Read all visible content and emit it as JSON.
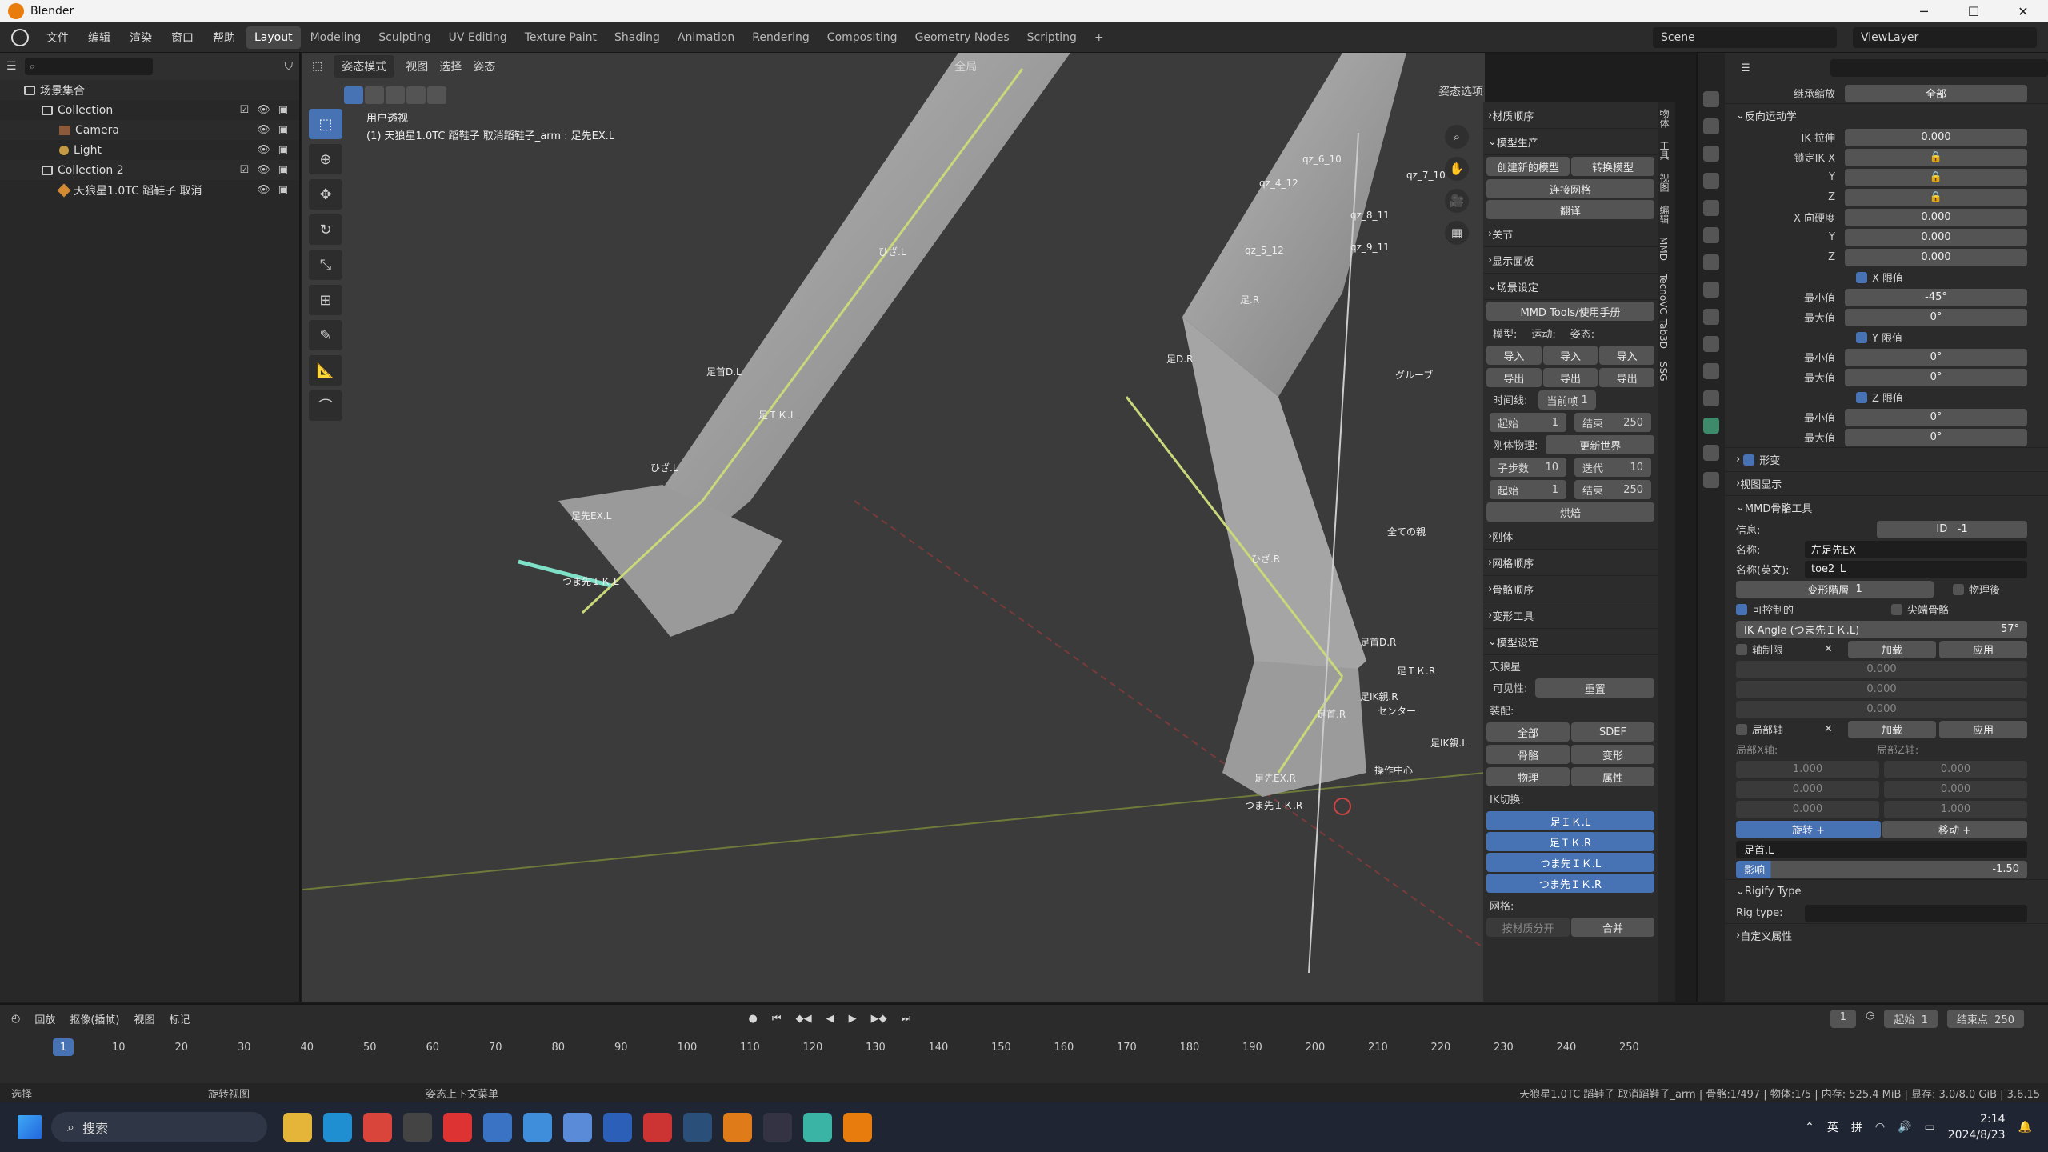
{
  "window": {
    "title": "Blender",
    "controls": [
      "─",
      "☐",
      "✕"
    ]
  },
  "menubar": {
    "menus": [
      "文件",
      "编辑",
      "渲染",
      "窗口",
      "帮助"
    ],
    "workspaces": [
      "Layout",
      "Modeling",
      "Sculpting",
      "UV Editing",
      "Texture Paint",
      "Shading",
      "Animation",
      "Rendering",
      "Compositing",
      "Geometry Nodes",
      "Scripting"
    ],
    "active_workspace": "Layout",
    "add_tab": "+",
    "scene": "Scene",
    "view_layer": "ViewLayer"
  },
  "outliner": {
    "root": "场景集合",
    "rows": [
      {
        "label": "Collection",
        "indent": 1,
        "type": "collection"
      },
      {
        "label": "Camera",
        "indent": 2,
        "type": "camera"
      },
      {
        "label": "Light",
        "indent": 2,
        "type": "light"
      },
      {
        "label": "Collection 2",
        "indent": 1,
        "type": "collection"
      },
      {
        "label": "天狼星1.0TC 蹈鞋子 取消",
        "indent": 2,
        "type": "armature"
      }
    ]
  },
  "viewport": {
    "mode": "姿态模式",
    "header_menus": [
      "视图",
      "选择",
      "姿态"
    ],
    "pivot": "全局",
    "overlay_label": "姿态选项",
    "info_line1": "用户透视",
    "info_line2": "(1) 天狼星1.0TC 蹈鞋子 取消蹈鞋子_arm : 足先EX.L",
    "bone_labels": [
      "ひざ.L",
      "足首D.L",
      "足ＩＫ.L",
      "ひざ.L",
      "足先EX.L",
      "つま先ＩＫ.L",
      "ひざ.R",
      "足首D.R",
      "足ＩＫ.R",
      "足IK親.R",
      "センター",
      "足首.R",
      "足先EX.R",
      "つま先ＩＫ.R",
      "操作中心",
      "足IK親.L",
      "グルーブ",
      "全ての親",
      "足.R",
      "足D.R",
      "qz_8_11",
      "qz_9_11",
      "qz_6_10",
      "qz_7_10",
      "qz_4_12",
      "qz_5_12"
    ]
  },
  "npanel": {
    "sections": {
      "material_order": "材质顺序",
      "model_production": "模型生产",
      "create_model": "创建新的模型",
      "convert_model": "转换模型",
      "join_meshes": "连接网格",
      "translate": "翻译",
      "joints": "关节",
      "display_panel": "显示面板",
      "scene_setup": "场景设定",
      "mmd_tools_manual": "MMD Tools/使用手册",
      "model": "模型:",
      "motion": "运动:",
      "pose": "姿态:",
      "import": "导入",
      "export": "导出",
      "timeline": "时间线:",
      "current_frame_label": "当前帧",
      "current_frame": "1",
      "start_label": "起始",
      "start": "1",
      "end_label": "结束",
      "end": "250",
      "rigid_physics": "刚体物理:",
      "update_world": "更新世界",
      "substeps_label": "子步数",
      "substeps": "10",
      "iterations_label": "迭代",
      "iterations": "10",
      "bake": "烘焙",
      "rigid_body": "刚体",
      "mesh_order": "网格顺序",
      "bone_order": "骨骼顺序",
      "morph_tools": "变形工具",
      "model_setup": "模型设定",
      "model_name": "天狼星",
      "visibility": "可见性:",
      "reset": "重置",
      "assembly": "装配:",
      "all": "全部",
      "sdef": "SDEF",
      "bones": "骨骼",
      "morph": "变形",
      "physics": "物理",
      "properties": "属性",
      "ik_switch": "IK切换:",
      "mesh": "网格:",
      "separate_by_material": "按材质分开",
      "merge": "合并"
    },
    "ik_buttons": [
      "足ＩＫ.L",
      "足ＩＫ.R",
      "つま先ＩＫ.L",
      "つま先ＩＫ.R"
    ],
    "vertical_tabs": [
      "物体",
      "工具",
      "视图",
      "编辑",
      "MMD",
      "TecnoVC_Tab3D",
      "SSG"
    ]
  },
  "properties": {
    "inherit_scale_label": "继承缩放",
    "inherit_scale": "全部",
    "inverse_kinematics": "反向运动学",
    "ik_stretch_label": "IK 拉伸",
    "ik_stretch": "0.000",
    "lock_ik_x": "锁定IK X",
    "y": "Y",
    "z": "Z",
    "x_stiffness_label": "X 向硬度",
    "stiffness": [
      "0.000",
      "0.000",
      "0.000"
    ],
    "x_limit": "X 限值",
    "x_min_label": "最小值",
    "x_min": "-45°",
    "x_max_label": "最大值",
    "x_max": "0°",
    "y_limit": "Y 限值",
    "y_min": "0°",
    "y_max": "0°",
    "z_limit": "Z 限值",
    "z_min": "0°",
    "z_max": "0°",
    "deform": "形变",
    "viewport_display": "视图显示",
    "mmd_bone_tools": "MMD骨骼工具",
    "info_label": "信息:",
    "id_label": "ID",
    "id_value": "-1",
    "name_label": "名称:",
    "name_value": "左足先EX",
    "name_en_label": "名称(英文):",
    "name_en_value": "toe2_L",
    "deform_layer_label": "变形階層",
    "deform_layer": "1",
    "after_physics": "物理後",
    "controllable": "可控制的",
    "tip_bone": "尖端骨骼",
    "ik_angle_label": "IK Angle (つま先ＩＫ.L)",
    "ik_angle": "57°",
    "axis_limit": "轴制限",
    "add": "加载",
    "apply": "应用",
    "axis_values": [
      "0.000",
      "0.000",
      "0.000"
    ],
    "local_axis": "局部轴",
    "local_x_axis": "局部X轴:",
    "local_z_axis": "局部Z轴:",
    "local_x": [
      "1.000",
      "0.000",
      "0.000"
    ],
    "local_z": [
      "0.000",
      "0.000",
      "1.000"
    ],
    "rotate_plus": "旋转 +",
    "move_plus": "移动 +",
    "parent_bone": "足首.L",
    "influence_label": "影响",
    "influence": "-1.50",
    "rigify_type": "Rigify Type",
    "rig_type_label": "Rig type:",
    "custom_props": "自定义属性"
  },
  "timeline": {
    "menus": [
      "回放",
      "抠像(插帧)",
      "视图",
      "标记"
    ],
    "current_frame": "1",
    "start_label": "起始",
    "start": "1",
    "end_label": "结束点",
    "end": "250",
    "ticks": [
      "10",
      "20",
      "30",
      "40",
      "50",
      "60",
      "70",
      "80",
      "90",
      "100",
      "110",
      "120",
      "130",
      "140",
      "150",
      "160",
      "170",
      "180",
      "190",
      "200",
      "210",
      "220",
      "230",
      "240",
      "250"
    ]
  },
  "statusbar": {
    "select": "选择",
    "rotate_view": "旋转视图",
    "context_menu": "姿态上下文菜单",
    "stats": "天狼星1.0TC 蹈鞋子 取消蹈鞋子_arm | 骨骼:1/497 | 物体:1/5 | 内存: 525.4 MiB | 显存: 3.0/8.0 GiB | 3.6.15"
  },
  "taskbar": {
    "search": "搜索",
    "ime1": "英",
    "ime2": "拼",
    "time": "2:14",
    "date": "2024/8/23"
  }
}
